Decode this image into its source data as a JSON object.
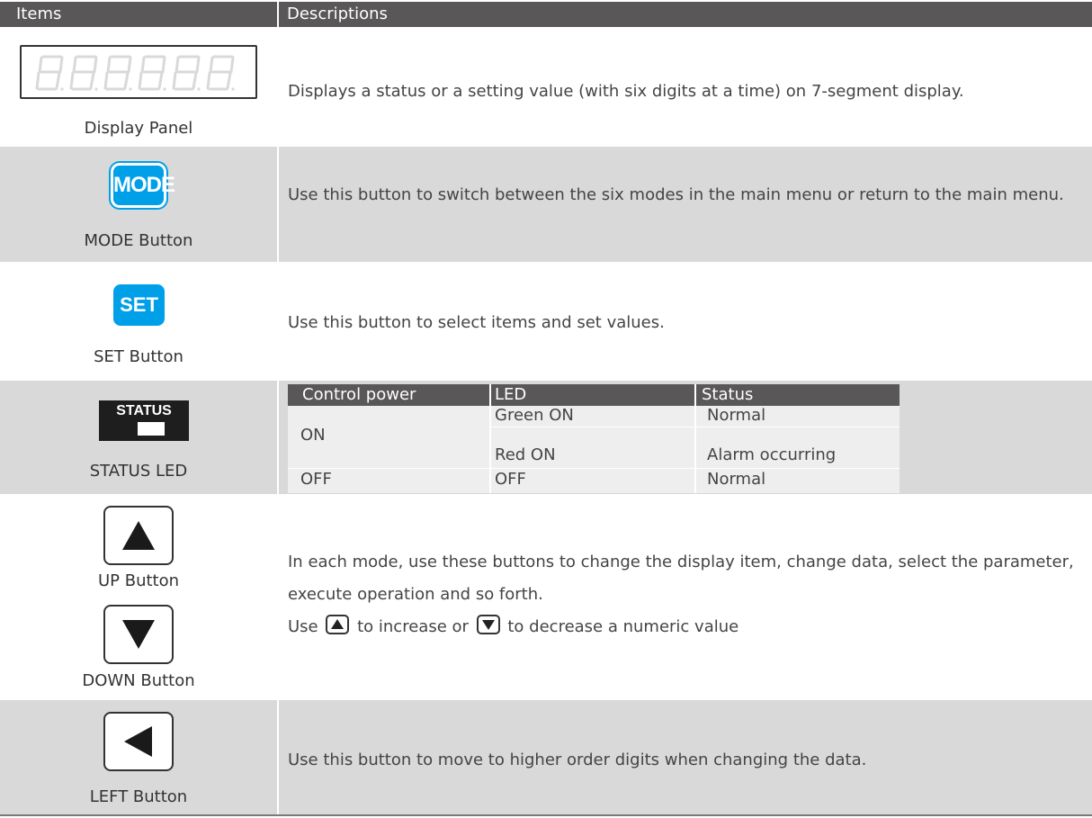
{
  "header": {
    "col_items": "Items",
    "col_descriptions": "Descriptions"
  },
  "rows": [
    {
      "label": "Display Panel",
      "icon": "seven-segment-display",
      "description": "Displays a status or a setting value (with six digits at a time) on 7-segment display."
    },
    {
      "label": "MODE Button",
      "icon_text": "MODE",
      "description": "Use this button to switch between the six modes in the main menu or return to the main menu."
    },
    {
      "label": "SET Button",
      "icon_text": "SET",
      "description": "Use this button to select items and set values."
    },
    {
      "label": "STATUS LED",
      "icon_text": "STATUS",
      "table": {
        "headers": [
          "Control power",
          "LED",
          "Status"
        ],
        "rows": [
          {
            "power": "ON",
            "led": "Green ON",
            "status": "Normal"
          },
          {
            "power": "",
            "led": "Red ON",
            "status": "Alarm occurring"
          },
          {
            "power": "OFF",
            "led": "OFF",
            "status": "Normal"
          }
        ]
      }
    },
    {
      "label_up": "UP Button",
      "label_down": "DOWN Button",
      "icon_up": "up-arrow-icon",
      "icon_down": "down-arrow-icon",
      "description_line1": "In each mode, use these buttons to change the display item, change data, select the parameter, execute operation and so forth.",
      "use_prefix": "Use",
      "use_mid": "to increase or",
      "use_suffix": "to decrease a numeric value"
    },
    {
      "label": "LEFT Button",
      "icon": "left-arrow-icon",
      "description": "Use this button to move to higher order digits when changing the data."
    }
  ],
  "colors": {
    "header_bg": "#595757",
    "row_shade": "#d9d9d9",
    "button_blue": "#00a0e9",
    "led_table_bg": "#eeeeee"
  }
}
